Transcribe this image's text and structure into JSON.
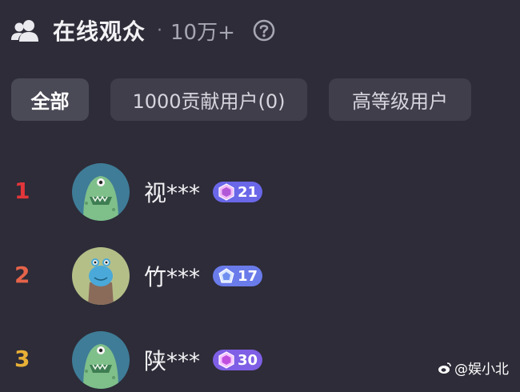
{
  "header": {
    "title": "在线观众",
    "dot": "·",
    "count": "10万+",
    "users_icon": "users-icon",
    "help_icon": "question-circle-icon"
  },
  "tabs": [
    {
      "label": "全部",
      "active": true
    },
    {
      "label": "1000贡献用户(0)",
      "active": false
    },
    {
      "label": "高等级用户",
      "active": false
    }
  ],
  "viewers": [
    {
      "rank": "1",
      "rank_color": "#e2363b",
      "name": "视***",
      "level": "21",
      "badge_color": "#6a67e8",
      "avatar": "green-monster-avatar"
    },
    {
      "rank": "2",
      "rank_color": "#e5634a",
      "name": "竹***",
      "level": "17",
      "badge_color": "#6a7bea",
      "avatar": "blue-creature-avatar"
    },
    {
      "rank": "3",
      "rank_color": "#e8b036",
      "name": "陕***",
      "level": "30",
      "badge_color": "#7f5fe5",
      "avatar": "green-monster-avatar"
    }
  ],
  "watermark": {
    "text": "@娱小北",
    "icon": "weibo-icon"
  }
}
